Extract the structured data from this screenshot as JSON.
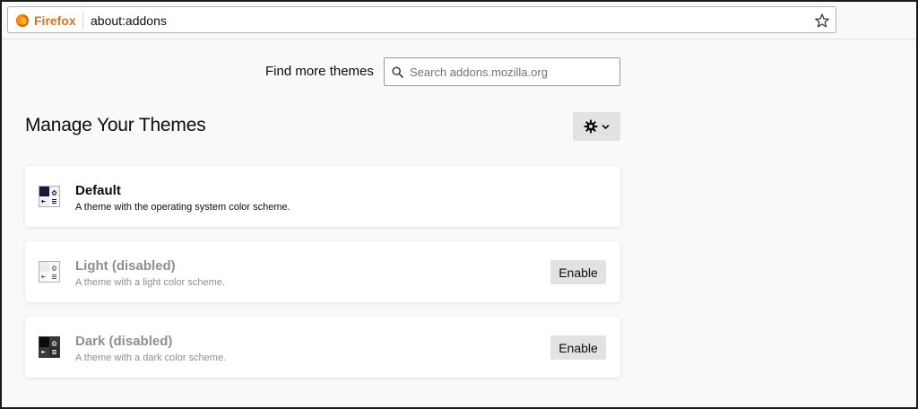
{
  "browser": {
    "identity_label": "Firefox",
    "url": "about:addons",
    "icons": {
      "identity": "firefox-logo-icon",
      "bookmark": "star-icon"
    }
  },
  "find_more": {
    "label": "Find more themes",
    "search_placeholder": "Search addons.mozilla.org",
    "search_value": ""
  },
  "page": {
    "title": "Manage Your Themes",
    "tools_icon": "gear-icon"
  },
  "themes": [
    {
      "name": "Default",
      "description": "A theme with the operating system color scheme.",
      "icon": "theme-default-icon",
      "state": "active"
    },
    {
      "name": "Light (disabled)",
      "description": "A theme with a light color scheme.",
      "icon": "theme-light-icon",
      "state": "disabled",
      "action_label": "Enable"
    },
    {
      "name": "Dark (disabled)",
      "description": "A theme with a dark color scheme.",
      "icon": "theme-dark-icon",
      "state": "disabled",
      "action_label": "Enable"
    }
  ],
  "colors": {
    "brand_orange": "#d7741f",
    "page_bg": "#f9f9fa",
    "disabled_text": "#8f8f93",
    "button_bg": "#e2e2e4"
  }
}
